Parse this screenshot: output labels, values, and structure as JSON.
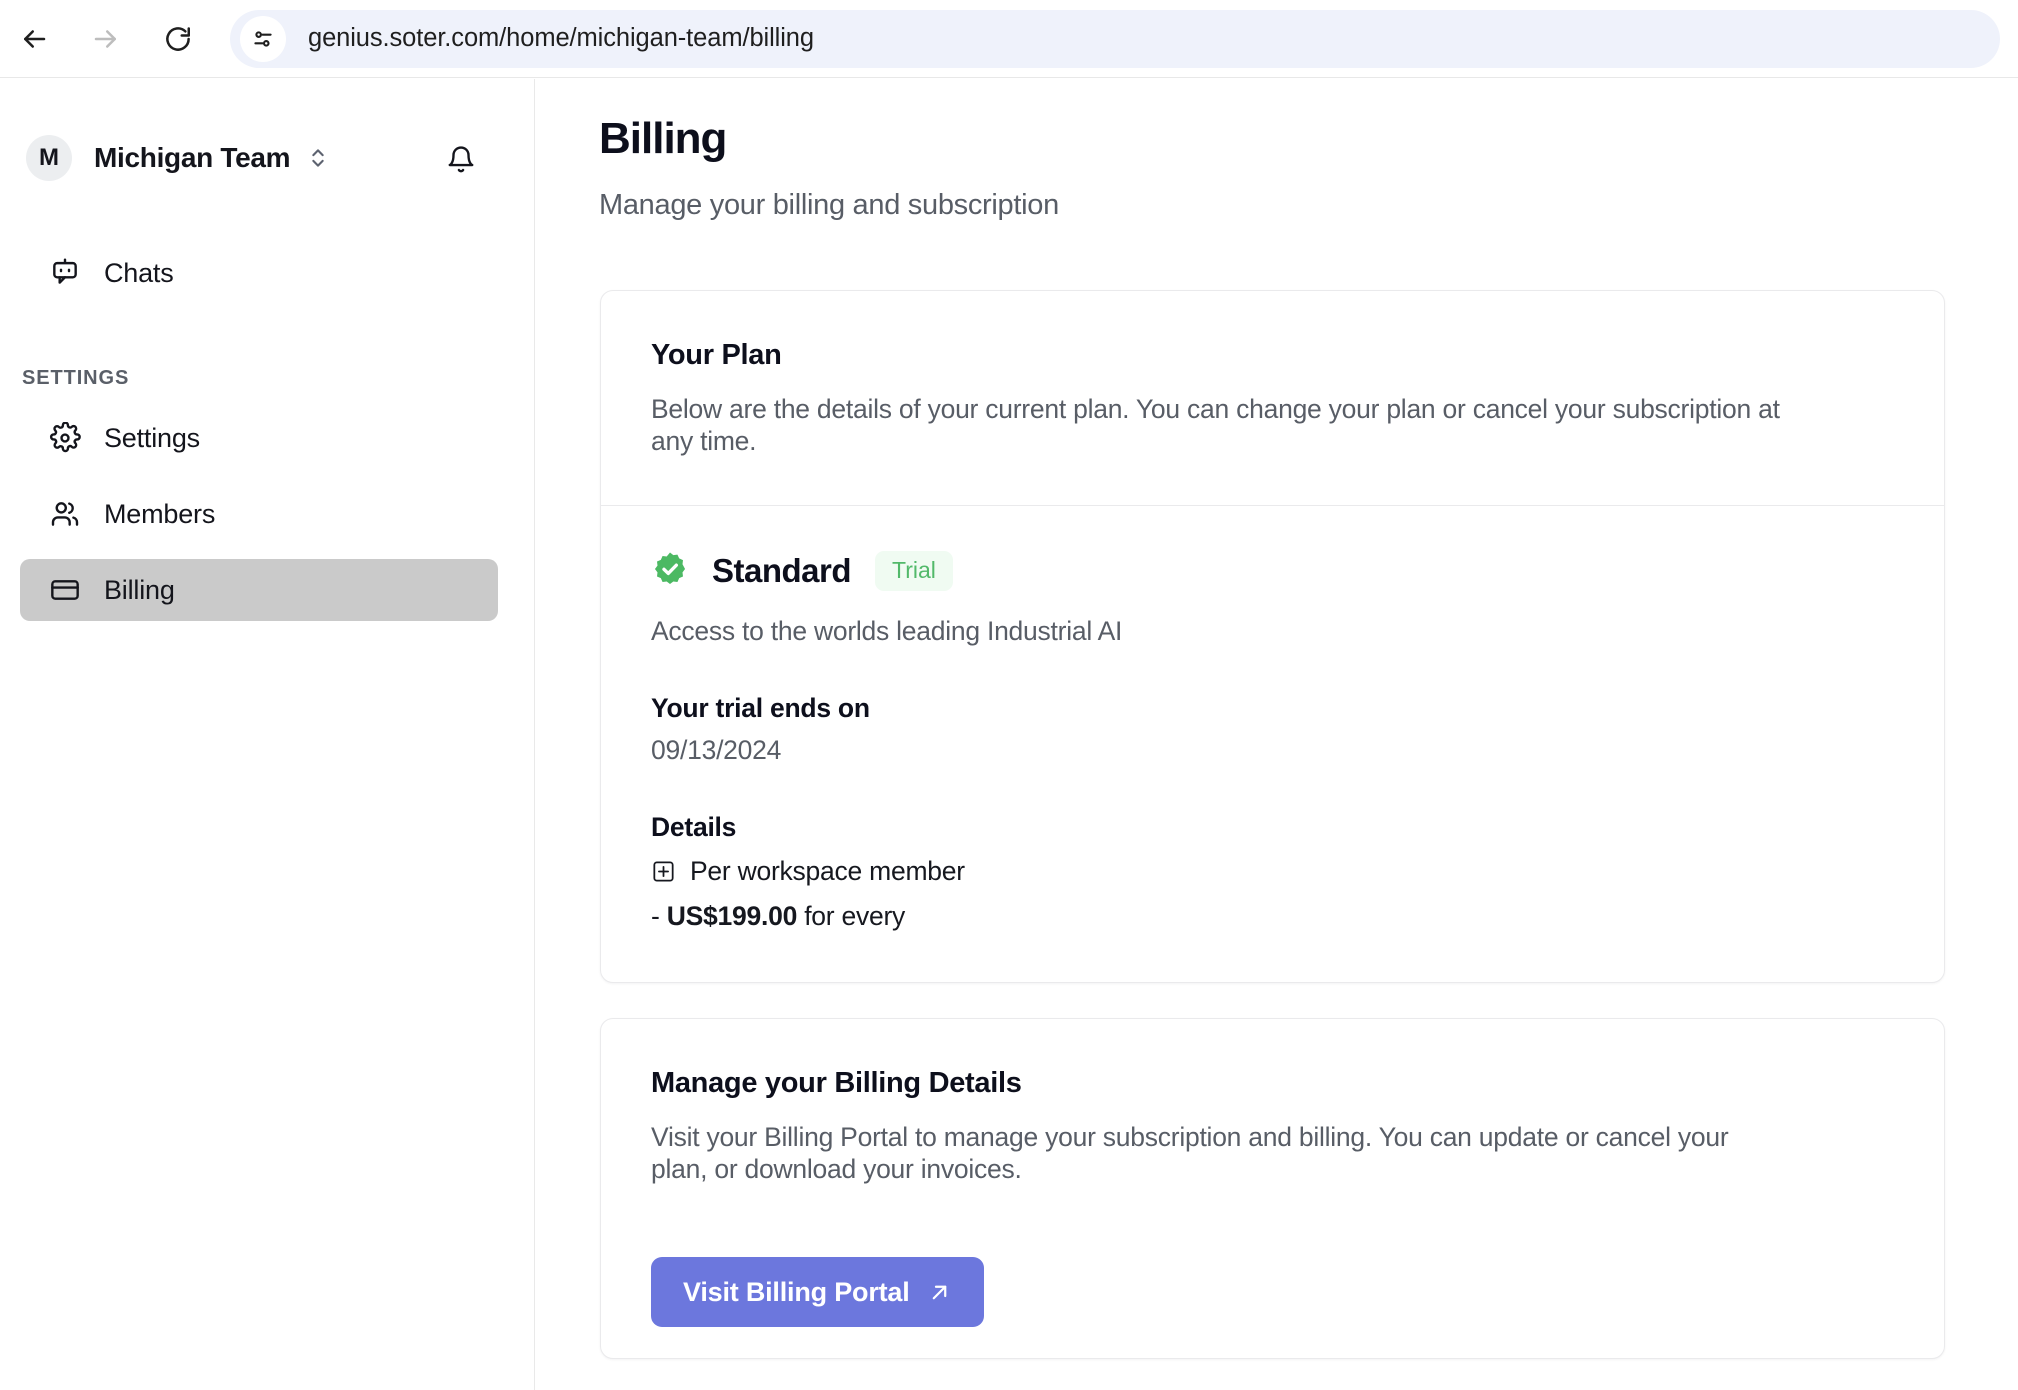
{
  "browser": {
    "url": "genius.soter.com/home/michigan-team/billing",
    "back_label": "Back",
    "forward_label": "Forward",
    "reload_label": "Reload",
    "site_settings_label": "Site information"
  },
  "sidebar": {
    "team": {
      "avatar_initial": "M",
      "name": "Michigan Team"
    },
    "notifications_label": "Notifications",
    "top_items": [
      {
        "label": "Chats",
        "icon": "chat-bot-icon",
        "active": false
      }
    ],
    "section_label": "SETTINGS",
    "settings_items": [
      {
        "label": "Settings",
        "icon": "gear-icon",
        "active": false
      },
      {
        "label": "Members",
        "icon": "users-icon",
        "active": false
      },
      {
        "label": "Billing",
        "icon": "credit-card-icon",
        "active": true
      }
    ]
  },
  "page": {
    "title": "Billing",
    "subtitle": "Manage your billing and subscription"
  },
  "plan_card": {
    "heading": "Your Plan",
    "description": "Below are the details of your current plan. You can change your plan or cancel your subscription at any time.",
    "plan_name": "Standard",
    "badge": "Trial",
    "plan_description": "Access to the worlds leading Industrial AI",
    "trial_label": "Your trial ends on",
    "trial_date": "09/13/2024",
    "details_label": "Details",
    "detail_item": "Per workspace member",
    "price_prefix": "-",
    "price_amount": "US$199.00",
    "price_suffix": "for every"
  },
  "manage_card": {
    "heading": "Manage your Billing Details",
    "description": "Visit your Billing Portal to manage your subscription and billing. You can update or cancel your plan, or download your invoices.",
    "button_label": "Visit Billing Portal"
  },
  "colors": {
    "accent": "#6C77DD",
    "badge_text": "#52B96A",
    "badge_bg": "#F0FBF2",
    "active_nav_bg": "#CACACA",
    "seal_green": "#4CB963"
  }
}
